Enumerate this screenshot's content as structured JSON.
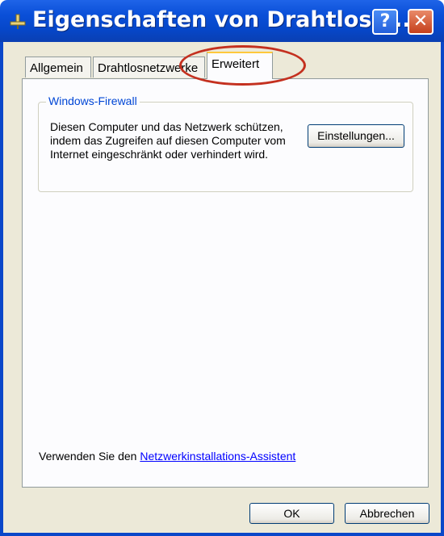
{
  "window": {
    "title": "Eigenschaften von Drahtlose ...",
    "help_button": "?",
    "close_button": "✕"
  },
  "tabs": [
    {
      "label": "Allgemein",
      "active": false
    },
    {
      "label": "Drahtlosnetzwerke",
      "active": false
    },
    {
      "label": "Erweitert",
      "active": true
    }
  ],
  "firewall": {
    "group_title": "Windows-Firewall",
    "description": "Diesen Computer und das Netzwerk schützen, indem das Zugreifen auf diesen Computer vom Internet eingeschränkt oder verhindert wird.",
    "settings_button": "Einstellungen..."
  },
  "hint": {
    "prefix": "Verwenden Sie den ",
    "link": "Netzwerkinstallations-Assistent"
  },
  "footer": {
    "ok_button": "OK",
    "cancel_button": "Abbrechen"
  },
  "colors": {
    "titlebar": "#0a4fd8",
    "dialog_bg": "#ece9d8",
    "annotation_circle": "#c4301f",
    "group_title": "#0046d5"
  }
}
